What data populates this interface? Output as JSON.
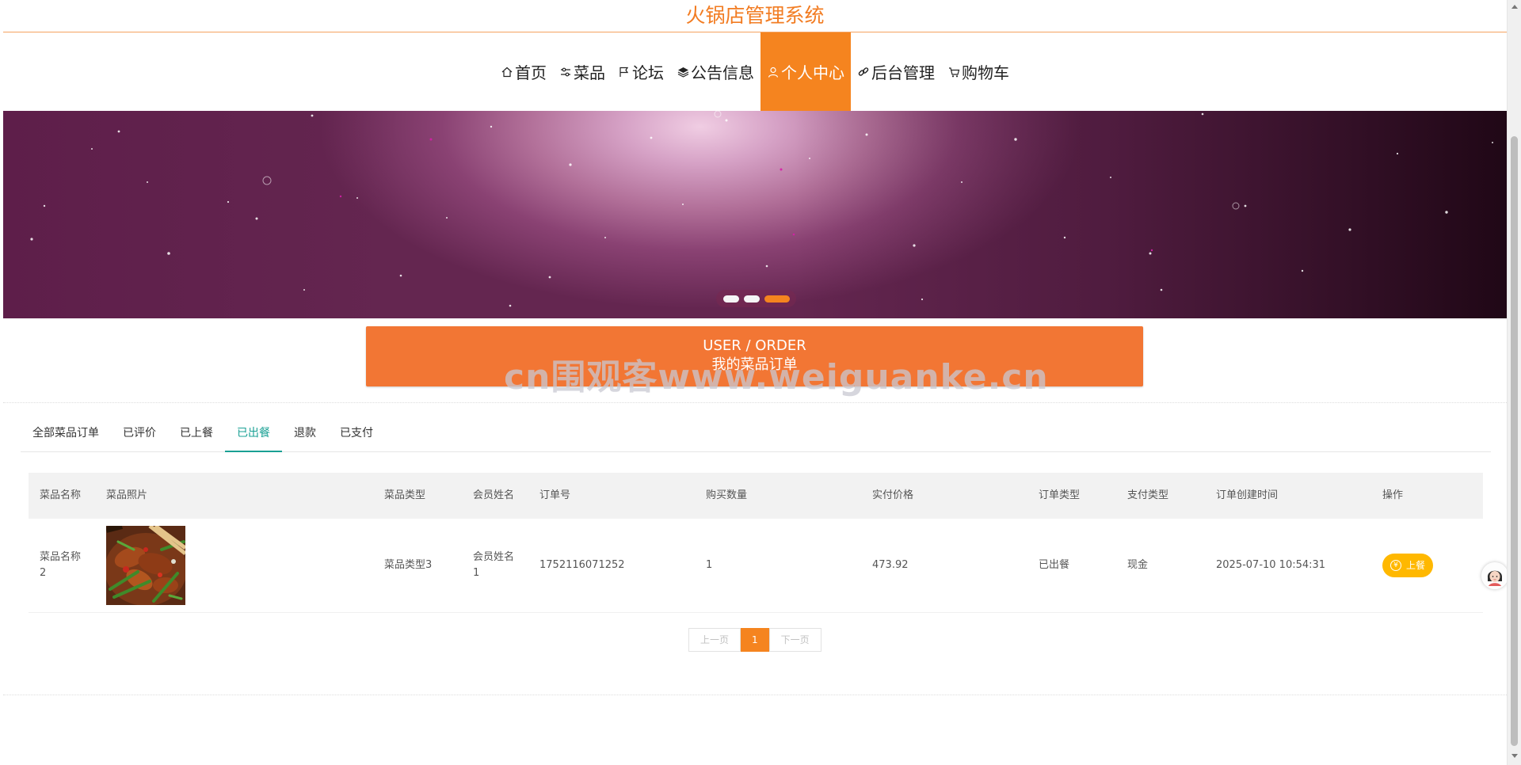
{
  "header": {
    "title": "火锅店管理系统"
  },
  "nav": {
    "items": [
      {
        "label": "首页",
        "icon": "home-icon"
      },
      {
        "label": "菜品",
        "icon": "sliders-icon"
      },
      {
        "label": "论坛",
        "icon": "flag-icon"
      },
      {
        "label": "公告信息",
        "icon": "layers-icon"
      },
      {
        "label": "个人中心",
        "icon": "user-icon",
        "active": true
      },
      {
        "label": "后台管理",
        "icon": "link-icon"
      },
      {
        "label": "购物车",
        "icon": "cart-icon"
      }
    ]
  },
  "banner": {
    "slides": 3,
    "active_slide": 3
  },
  "order_header": {
    "en": "USER / ORDER",
    "cn": "我的菜品订单"
  },
  "watermark": "cn围观客www.weiguanke.cn",
  "tabs": {
    "items": [
      "全部菜品订单",
      "已评价",
      "已上餐",
      "已出餐",
      "退款",
      "已支付"
    ],
    "active": "已出餐"
  },
  "table": {
    "columns": [
      "菜品名称",
      "菜品照片",
      "菜品类型",
      "会员姓名",
      "订单号",
      "购买数量",
      "实付价格",
      "订单类型",
      "支付类型",
      "订单创建时间",
      "操作"
    ],
    "rows": [
      {
        "name": "菜品名称2",
        "type": "菜品类型3",
        "member": "会员姓名1",
        "order_no": "1752116071252",
        "quantity": "1",
        "price": "473.92",
        "order_type": "已出餐",
        "pay_type": "现金",
        "created": "2025-07-10 10:54:31",
        "action": "上餐"
      }
    ]
  },
  "pager": {
    "prev": "上一页",
    "current": "1",
    "next": "下一页"
  },
  "colors": {
    "accent": "#f5841f",
    "tab_active": "#1aa094",
    "action": "#ffb800",
    "order_header": "#f27634"
  }
}
